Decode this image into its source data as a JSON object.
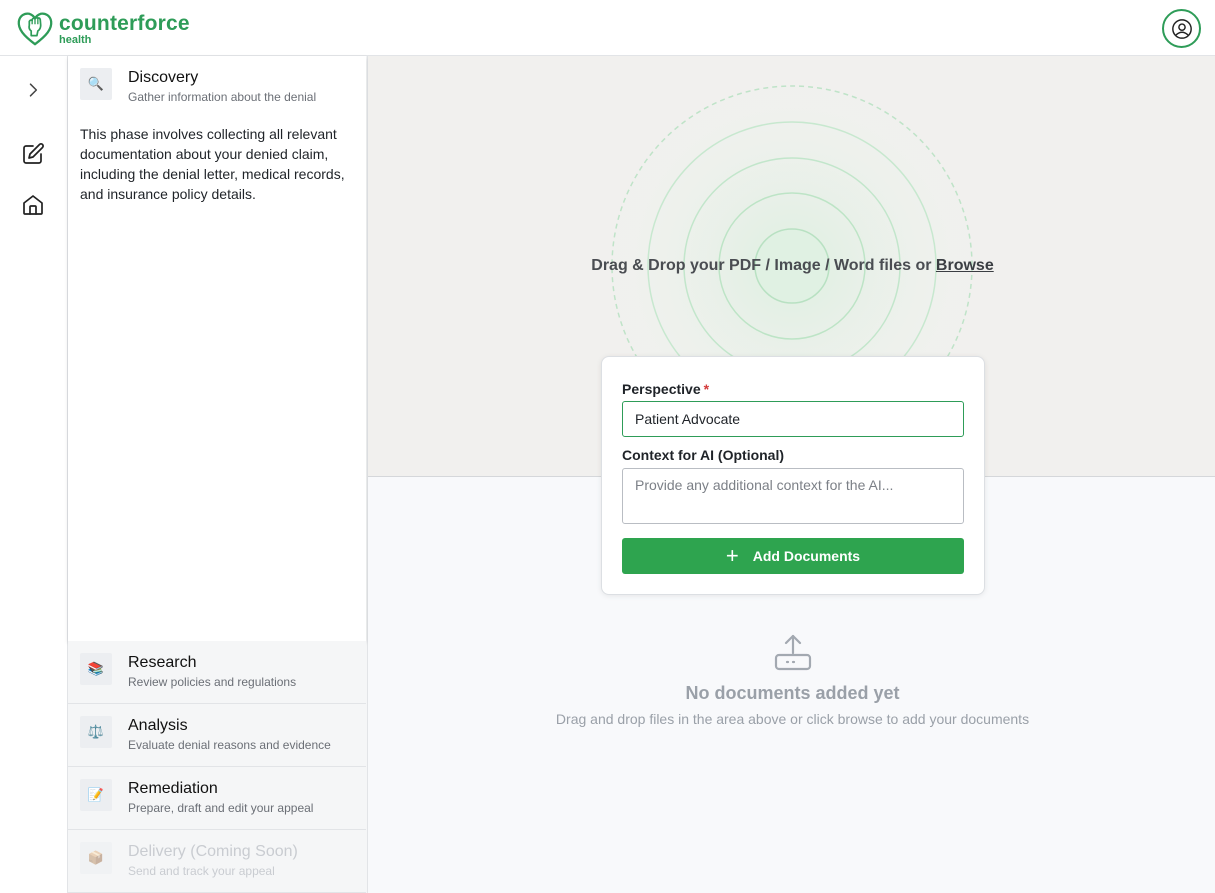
{
  "brand": {
    "name": "counterforce",
    "sub": "health",
    "color": "#2e9c58"
  },
  "header": {
    "user_icon": "user-circle-icon"
  },
  "rail": {
    "items": [
      "chevron-right-icon",
      "edit-icon",
      "home-icon"
    ]
  },
  "phases": {
    "active": {
      "icon": "🔍",
      "title": "Discovery",
      "subtitle": "Gather information about the denial",
      "description": "This phase involves collecting all relevant documentation about your denied claim, including the denial letter, medical records, and insurance policy details."
    },
    "items": [
      {
        "icon": "📚",
        "title": "Research",
        "subtitle": "Review policies and regulations"
      },
      {
        "icon": "⚖️",
        "title": "Analysis",
        "subtitle": "Evaluate denial reasons and evidence"
      },
      {
        "icon": "📝",
        "title": "Remediation",
        "subtitle": "Prepare, draft and edit your appeal"
      },
      {
        "icon": "📦",
        "title": "Delivery (Coming Soon)",
        "subtitle": "Send and track your appeal"
      }
    ]
  },
  "dropzone": {
    "text": "Drag & Drop your PDF / Image / Word files or",
    "browse": "Browse"
  },
  "form": {
    "perspective_label": "Perspective",
    "required_mark": "*",
    "perspective_value": "Patient Advocate",
    "context_label": "Context for AI (Optional)",
    "context_placeholder": "Provide any additional context for the AI...",
    "add_label": "Add Documents",
    "accent": "#2ea44f"
  },
  "empty": {
    "title": "No documents added yet",
    "subtitle": "Drag and drop files in the area above or click browse to add your documents"
  }
}
